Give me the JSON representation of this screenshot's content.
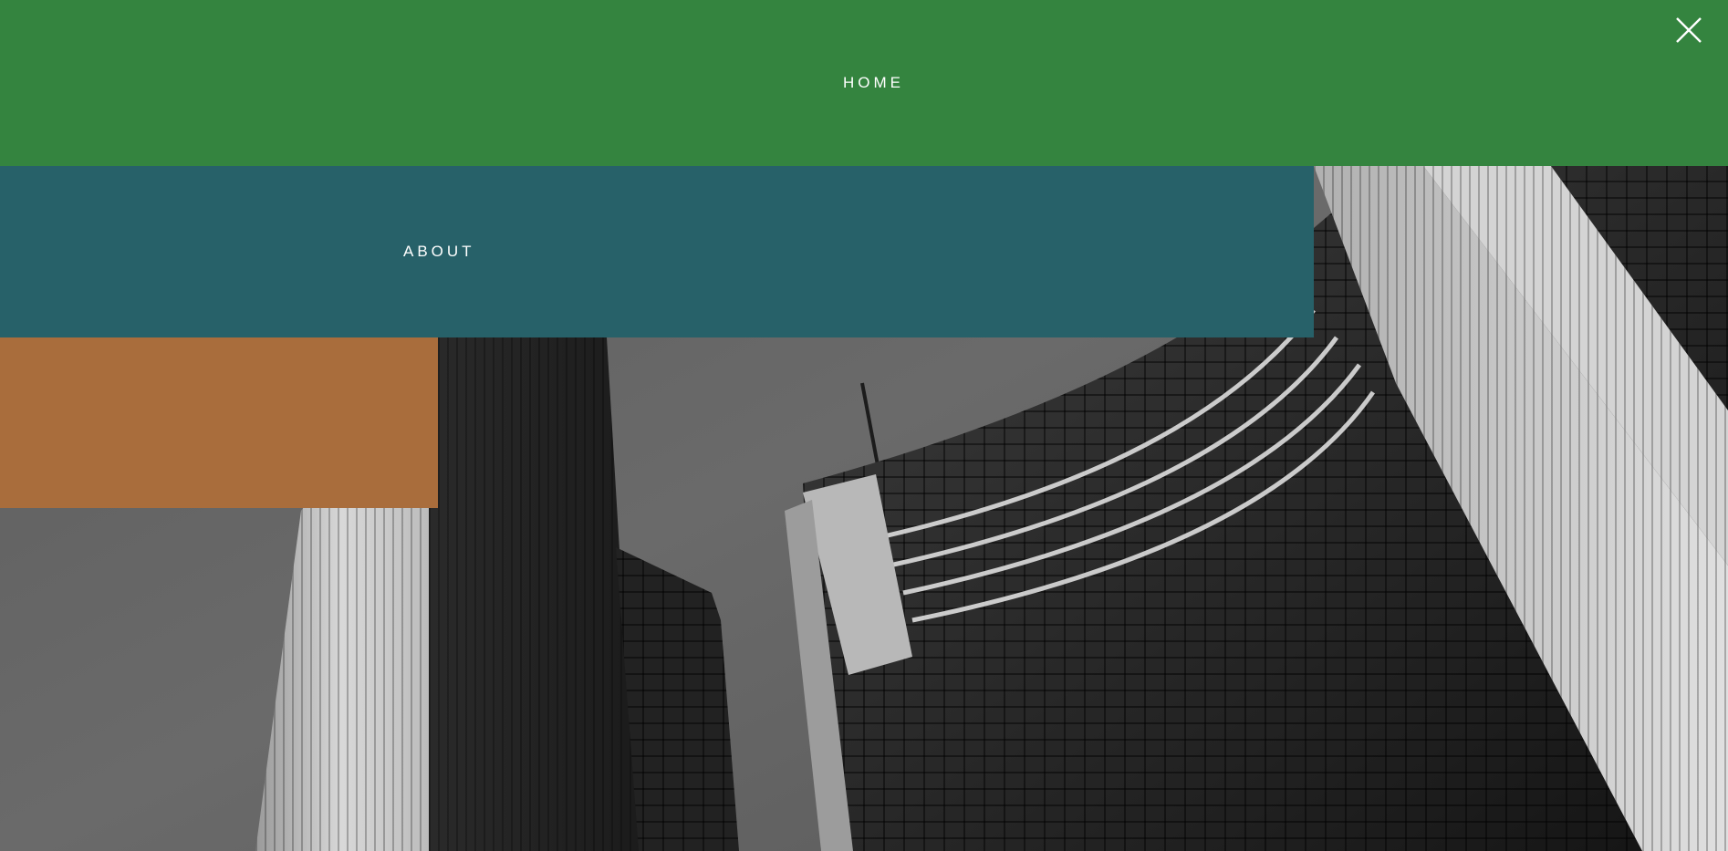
{
  "menu": {
    "items": [
      {
        "label": "HOME",
        "color": "#34843f"
      },
      {
        "label": "ABOUT",
        "color": "#276169"
      },
      {
        "label": "",
        "color": "#a96d3c"
      }
    ],
    "close_icon": "close-icon"
  },
  "background": {
    "icon": "building-photo",
    "style": "grayscale architectural photo"
  }
}
